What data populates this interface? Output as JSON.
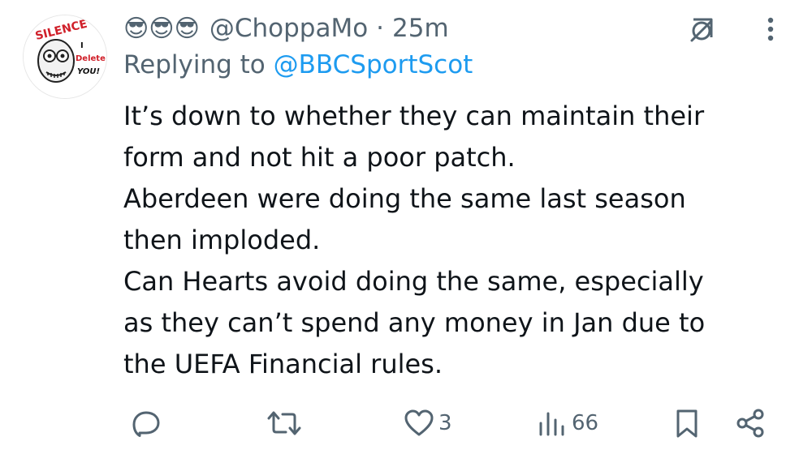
{
  "tweet": {
    "author_emojis": [
      "😎",
      "😎",
      "😎"
    ],
    "handle": "@ChoppaMo",
    "separator": "·",
    "time": "25m",
    "replying_prefix": "Replying to ",
    "replying_to": "@BBCSportScot",
    "body_lines": [
      "It’s down to whether they can maintain their",
      "form and not hit a poor patch.",
      "Aberdeen were doing the same last season",
      "then imploded.",
      "Can Hearts avoid doing the same, especially",
      "as they can’t spend any money in Jan due to",
      "the UEFA Financial rules."
    ],
    "avatar_text": {
      "top": "SILENCE",
      "side1": "I",
      "side2": "Delete",
      "side3": "YOU!"
    }
  },
  "actions": {
    "reply_icon": "reply-icon",
    "retweet_icon": "retweet-icon",
    "like_icon": "heart-icon",
    "like_count": "3",
    "views_icon": "views-icon",
    "views_count": "66",
    "bookmark_icon": "bookmark-icon",
    "share_icon": "share-icon"
  },
  "colors": {
    "text": "#0f1419",
    "secondary": "#536471",
    "mention": "#1d9bf0"
  }
}
